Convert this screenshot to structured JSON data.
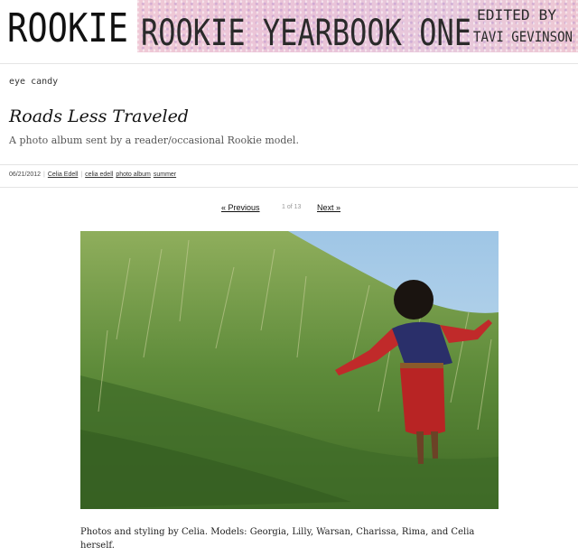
{
  "header": {
    "logo_text": "ROOKIE",
    "banner": {
      "title": "ROOKIE YEARBOOK ONE",
      "edited_by": "EDITED BY",
      "editor": "TAVI GEVINSON"
    }
  },
  "post": {
    "category": "eye candy",
    "title": "Roads Less Traveled",
    "subtitle": "A photo album sent by a reader/occasional Rookie model.",
    "date": "06/21/2012",
    "author": "Celia Edell",
    "tags": [
      "celia edell",
      "photo album",
      "summer"
    ]
  },
  "pagination": {
    "prev_label": "« Previous",
    "count": "1 of 13",
    "next_label": "Next »"
  },
  "photo": {
    "alt": "Woman in red dress walking through tall green grass on a hillside"
  },
  "caption": "Photos and styling by Celia. Models: Georgia, Lilly, Warsan, Charissa, Rima, and Celia herself.",
  "colors": {
    "banner_pink": "#ecc6d6",
    "link": "#111111",
    "grass": "#5e8b3a",
    "dress": "#c02a2a"
  }
}
